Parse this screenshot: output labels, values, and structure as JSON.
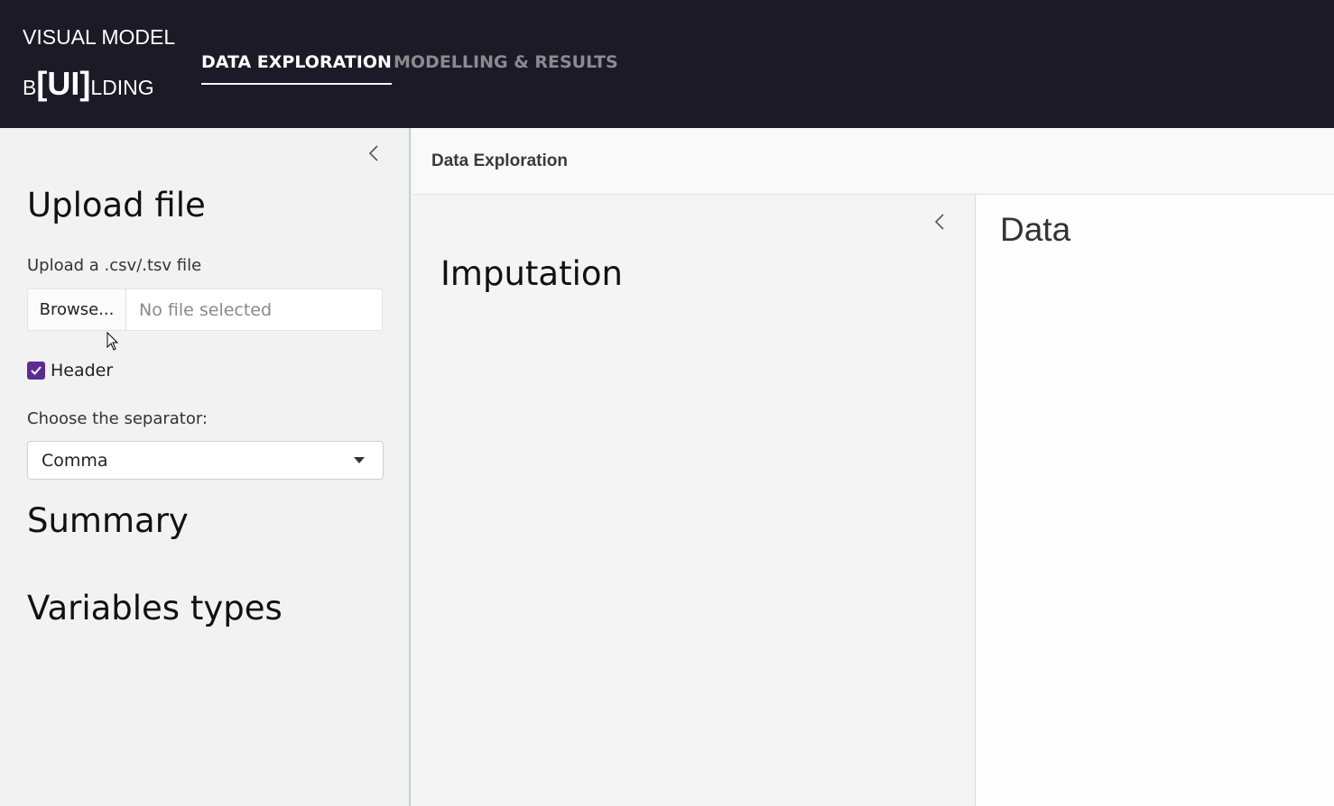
{
  "brand": {
    "line1": "VISUAL MODEL",
    "prefix": "B",
    "ui": "[UI]",
    "suffix": "LDING"
  },
  "nav": {
    "tabs": [
      {
        "label": "DATA EXPLORATION",
        "active": true
      },
      {
        "label": "MODELLING & RESULTS",
        "active": false
      }
    ]
  },
  "sidebar": {
    "collapse_icon": "chevron-left-icon",
    "upload_heading": "Upload file",
    "upload_label": "Upload a .csv/.tsv file",
    "browse_label": "Browse...",
    "file_placeholder": "No file selected",
    "header_checkbox": {
      "label": "Header",
      "checked": true
    },
    "separator_label": "Choose the separator:",
    "separator_value": "Comma",
    "summary_heading": "Summary",
    "variables_heading": "Variables types"
  },
  "main": {
    "title": "Data Exploration",
    "left_panel": {
      "heading": "Imputation"
    },
    "right_panel": {
      "heading": "Data"
    }
  },
  "colors": {
    "navbar_bg": "#1b1a26",
    "accent": "#5c2d91"
  }
}
